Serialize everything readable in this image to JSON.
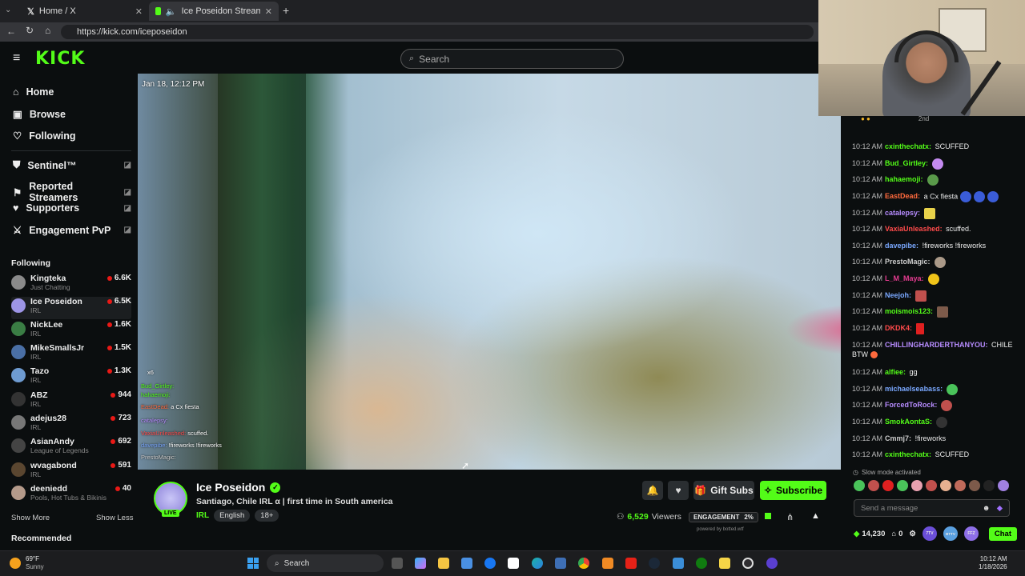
{
  "browser": {
    "tabs": [
      {
        "label": "Home / X",
        "active": false
      },
      {
        "label": "Ice Poseidon Stream - Watch",
        "active": true
      }
    ],
    "url": "https://kick.com/iceposeidon"
  },
  "header": {
    "logo": "KICK",
    "search_placeholder": "Search"
  },
  "sidebar": {
    "nav": [
      {
        "label": "Home",
        "icon": "home-icon"
      },
      {
        "label": "Browse",
        "icon": "browse-icon"
      },
      {
        "label": "Following",
        "icon": "heart-icon"
      }
    ],
    "custom": [
      {
        "label": "Sentinel™",
        "icon": "shield-icon"
      },
      {
        "label": "Reported Streamers",
        "icon": "flag-icon"
      },
      {
        "label": "Supporters",
        "icon": "heart-icon"
      },
      {
        "label": "Engagement PvP",
        "icon": "swords-icon"
      }
    ],
    "following_title": "Following",
    "following": [
      {
        "name": "Kingteka",
        "category": "Just Chatting",
        "viewers": "6.6K",
        "color": "#8a8a8a"
      },
      {
        "name": "Ice Poseidon",
        "category": "IRL",
        "viewers": "6.5K",
        "color": "#9d95e6"
      },
      {
        "name": "NickLee",
        "category": "IRL",
        "viewers": "1.6K",
        "color": "#3a7d44"
      },
      {
        "name": "MikeSmallsJr",
        "category": "IRL",
        "viewers": "1.5K",
        "color": "#4a6fa5"
      },
      {
        "name": "Tazo",
        "category": "IRL",
        "viewers": "1.3K",
        "color": "#6e9bd1"
      },
      {
        "name": "ABZ",
        "category": "IRL",
        "viewers": "944",
        "color": "#333333"
      },
      {
        "name": "adejus28",
        "category": "IRL",
        "viewers": "723",
        "color": "#777777"
      },
      {
        "name": "AsianAndy",
        "category": "League of Legends",
        "viewers": "692",
        "color": "#444444"
      },
      {
        "name": "wvagabond",
        "category": "IRL",
        "viewers": "591",
        "color": "#5a4630"
      },
      {
        "name": "deeniedd",
        "category": "Pools, Hot Tubs & Bikinis",
        "viewers": "40",
        "color": "#b49a8a"
      }
    ],
    "show_more": "Show More",
    "show_less": "Show Less",
    "recommended": "Recommended"
  },
  "video": {
    "timestamp": "Jan 18, 12:12 PM",
    "overlay_chat": [
      {
        "user": "Bud_Girtley:",
        "text": "",
        "color": "#53fc18"
      },
      {
        "user": "hahaemoji:",
        "text": "",
        "color": "#53fc18"
      },
      {
        "user": "EastDead:",
        "text": "a Cx fiesta",
        "color": "#ff6a3d"
      },
      {
        "user": "catalepsy:",
        "text": "",
        "color": "#b78cff"
      },
      {
        "user": "VaxiaUnleashed:",
        "text": "scuffed.",
        "color": "#ff4b4b"
      },
      {
        "user": "davepibe:",
        "text": "!fireworks !fireworks",
        "color": "#7aa8ff"
      },
      {
        "user": "PrestoMagic:",
        "text": "",
        "color": "#cccccc"
      }
    ],
    "overlay_badge": "x6"
  },
  "stream": {
    "channel": "Ice Poseidon",
    "title": "Santiago, Chile IRL α | first time in South america",
    "live_label": "LIVE",
    "tags": [
      "IRL",
      "English",
      "18+"
    ],
    "gift_label": "Gift Subs",
    "subscribe_label": "Subscribe",
    "viewers": "6,529",
    "viewers_label": "Viewers",
    "engagement_label": "ENGAGEMENT",
    "engagement_value": "2%",
    "powered_by": "powered by botted.wtf"
  },
  "chat": {
    "top_rank": "2nd",
    "messages": [
      {
        "time": "10:12 AM",
        "user": "cxinthechatx:",
        "text": "SCUFFED",
        "color": "#53fc18",
        "emotes": []
      },
      {
        "time": "10:12 AM",
        "user": "Bud_Girtley:",
        "text": "",
        "color": "#53fc18",
        "emotes": [
          "#c48bf0"
        ]
      },
      {
        "time": "10:12 AM",
        "user": "hahaemoji:",
        "text": "",
        "color": "#53fc18",
        "emotes": [
          "#5a9a4a"
        ]
      },
      {
        "time": "10:12 AM",
        "user": "EastDead:",
        "text": "a Cx fiesta",
        "color": "#ff6a3d",
        "emotes": [
          "#3a5cd8",
          "#3a5cd8",
          "#3a5cd8"
        ]
      },
      {
        "time": "10:12 AM",
        "user": "catalepsy:",
        "text": "",
        "color": "#b78cff",
        "emotes": [
          "#e8d24a"
        ]
      },
      {
        "time": "10:12 AM",
        "user": "VaxiaUnleashed:",
        "text": "scuffed.",
        "color": "#ff4b4b",
        "emotes": []
      },
      {
        "time": "10:12 AM",
        "user": "davepibe:",
        "text": "!fireworks !fireworks",
        "color": "#7aa8ff",
        "emotes": []
      },
      {
        "time": "10:12 AM",
        "user": "PrestoMagic:",
        "text": "",
        "color": "#cccccc",
        "emotes": [
          "#aa9988"
        ]
      },
      {
        "time": "10:12 AM",
        "user": "L_M_Maya:",
        "text": "",
        "color": "#e33b8f",
        "emotes": [
          "#f0c419"
        ]
      },
      {
        "time": "10:12 AM",
        "user": "Neejoh:",
        "text": "",
        "color": "#7aa8ff",
        "emotes": [
          "#c0504d"
        ]
      },
      {
        "time": "10:12 AM",
        "user": "moismois123:",
        "text": "",
        "color": "#53fc18",
        "emotes": [
          "#7d5a4a"
        ]
      },
      {
        "time": "10:12 AM",
        "user": "DKDK4:",
        "text": "",
        "color": "#ff4b4b",
        "emotes": [
          "#e02020"
        ]
      },
      {
        "time": "10:12 AM",
        "user": "CHILLINGHARDERTHANYOU:",
        "text": "CHILE BTW",
        "color": "#b78cff",
        "emotes": [
          "#ff6a3d"
        ]
      },
      {
        "time": "10:12 AM",
        "user": "alfiee:",
        "text": "gg",
        "color": "#53fc18",
        "emotes": []
      },
      {
        "time": "10:12 AM",
        "user": "michaelseabass:",
        "text": "",
        "color": "#7aa8ff",
        "emotes": [
          "#4ac35a"
        ]
      },
      {
        "time": "10:12 AM",
        "user": "ForcedToRock:",
        "text": "",
        "color": "#b78cff",
        "emotes": [
          "#c0504d"
        ]
      },
      {
        "time": "10:12 AM",
        "user": "SmokAontaS:",
        "text": "",
        "color": "#53fc18",
        "emotes": [
          "#333333"
        ]
      },
      {
        "time": "10:12 AM",
        "user": "Cmmj7:",
        "text": "!fireworks",
        "color": "#cccccc",
        "emotes": []
      },
      {
        "time": "10:12 AM",
        "user": "cxinthechatx:",
        "text": "SCUFFED",
        "color": "#53fc18",
        "emotes": []
      }
    ],
    "slow_mode": "Slow mode activated",
    "input_placeholder": "Send a message",
    "points": "14,230",
    "gifts_count": "0",
    "chat_button": "Chat",
    "ttv_label": "7TV",
    "bttv_label": "BTTV",
    "ffz_label": "FFZ"
  },
  "taskbar": {
    "weather_temp": "69°F",
    "weather_desc": "Sunny",
    "search_label": "Search",
    "time": "10:12 AM",
    "date": "1/18/2026"
  }
}
